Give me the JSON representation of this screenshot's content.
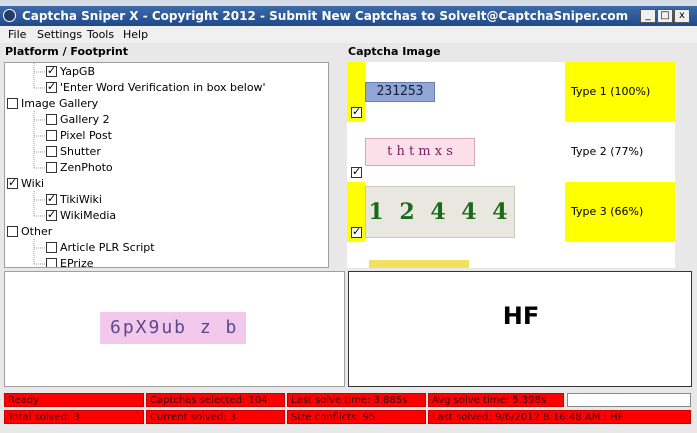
{
  "window": {
    "title": "Captcha Sniper X - Copyright 2012 - Submit New Captchas to SolveIt@CaptchaSniper.com",
    "min_label": "_",
    "max_label": "□",
    "close_label": "x"
  },
  "menu": [
    "File",
    "Settings",
    "Tools",
    "Help"
  ],
  "platform": {
    "title": "Platform / Footprint",
    "items": [
      {
        "label": "YapGB",
        "checked": true,
        "level": 1
      },
      {
        "label": "'Enter Word Verification in box below'",
        "checked": true,
        "level": 1
      },
      {
        "label": "Image Gallery",
        "checked": false,
        "level": 0
      },
      {
        "label": "Gallery 2",
        "checked": false,
        "level": 1
      },
      {
        "label": "Pixel Post",
        "checked": false,
        "level": 1
      },
      {
        "label": "Shutter",
        "checked": false,
        "level": 1
      },
      {
        "label": "ZenPhoto",
        "checked": false,
        "level": 1
      },
      {
        "label": "Wiki",
        "checked": true,
        "level": 0
      },
      {
        "label": "TikiWiki",
        "checked": true,
        "level": 1
      },
      {
        "label": "WikiMedia",
        "checked": true,
        "level": 1
      },
      {
        "label": "Other",
        "checked": false,
        "level": 0
      },
      {
        "label": "Article PLR Script",
        "checked": false,
        "level": 1
      },
      {
        "label": "EPrize",
        "checked": false,
        "level": 1
      }
    ]
  },
  "captcha": {
    "title": "Captcha Image",
    "rows": [
      {
        "image_text": "231253",
        "type_label": "Type 1 (100%)",
        "highlight": true
      },
      {
        "image_text": "t h t m x s",
        "type_label": "Type 2 (77%)",
        "highlight": false
      },
      {
        "image_text": "1 2 4 4 4",
        "type_label": "Type 3 (66%)",
        "highlight": true
      }
    ],
    "highlight_color": "#ffff00"
  },
  "preview": {
    "captcha_text": "6pX9ub z b"
  },
  "answer": {
    "text": "HF"
  },
  "status": {
    "ready": "Ready",
    "captchas_selected": "Captchas selected: 104",
    "last_solve_time": "Last solve time: 3.885s",
    "avg_solve_time": "Avg solve time: 5.398s",
    "total_solved": "Total solved: 3",
    "current_solved": "Current solved: 3",
    "size_conflicts": "Size conflicts: 95",
    "last_solved": "Last solved: 9/6/2012 8:16:48 AM : HF",
    "progress": 0.0
  },
  "colors": {
    "status_bg": "#ff0000",
    "title_bg": "#1f4a8a"
  }
}
